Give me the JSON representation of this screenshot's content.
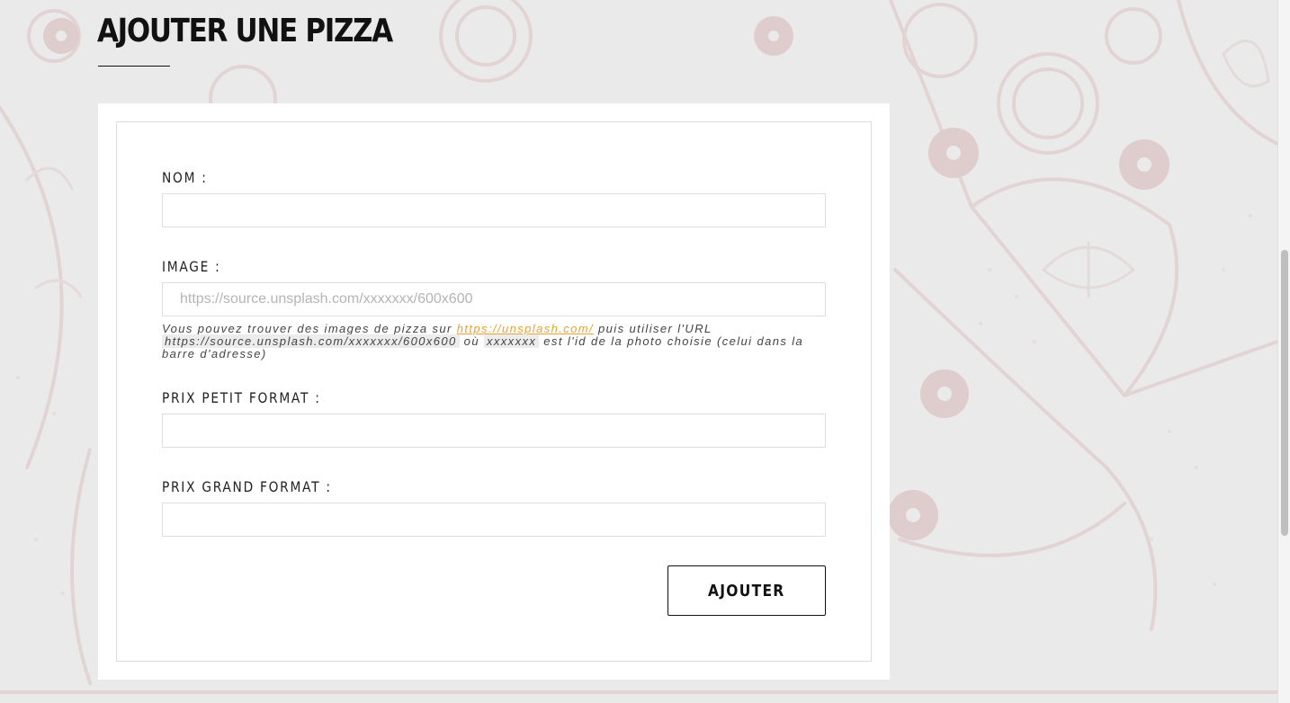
{
  "page": {
    "title": "AJOUTER UNE PIZZA"
  },
  "form": {
    "nom": {
      "label": "NOM :",
      "value": "",
      "placeholder": ""
    },
    "image": {
      "label": "IMAGE :",
      "value": "",
      "placeholder": "https://source.unsplash.com/xxxxxxx/600x600"
    },
    "help": {
      "part1": "Vous pouvez trouver des images de pizza sur ",
      "link": "https://unsplash.com/",
      "part2": " puis utiliser l'URL ",
      "code_url": "https://source.unsplash.com/xxxxxxx/600x600",
      "part3": " où ",
      "code_id": "xxxxxxx",
      "part4": " est l'id de la photo choisie (celui dans la barre d'adresse)"
    },
    "prix_petit": {
      "label": "PRIX PETIT FORMAT :",
      "value": "",
      "placeholder": ""
    },
    "prix_grand": {
      "label": "PRIX GRAND FORMAT :",
      "value": "",
      "placeholder": ""
    },
    "submit_label": "AJOUTER"
  },
  "theme": {
    "background": "#ebeaea",
    "art_stroke": "#e3d6d6",
    "link_color": "#e8a233"
  }
}
